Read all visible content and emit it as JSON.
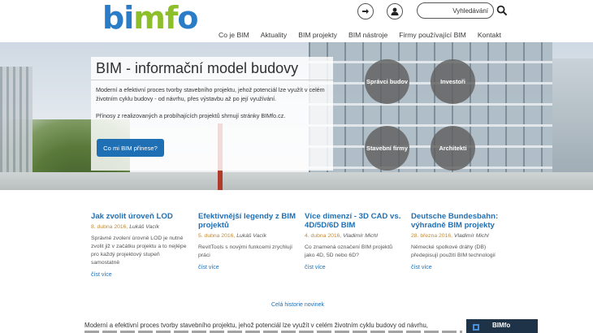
{
  "header": {
    "logo": {
      "letters": [
        "b",
        "i",
        "m",
        "f",
        "o"
      ]
    },
    "search_placeholder": "Vyhledávání",
    "nav": [
      "Co je BIM",
      "Aktuality",
      "BIM projekty",
      "BIM nástroje",
      "Firmy používající BIM",
      "Kontakt"
    ]
  },
  "hero": {
    "title": "BIM - informační model budovy",
    "text1": "Moderní a efektivní proces tvorby stavebního projektu, jehož potenciál lze využít v celém životním cyklu budovy - od návrhu, přes výstavbu až po její využívání.",
    "text2": "Přínosy z realizovaných a probíhajících projektů shrnují stránky BIMfo.cz.",
    "button_label": "Co mi BIM přinese?",
    "bubbles": [
      "Správci budov",
      "Investoři",
      "Stavební firmy",
      "Architekti"
    ]
  },
  "news": [
    {
      "title": "Jak zvolit úroveň LOD",
      "date": "8. dubna 2016,",
      "author": "Lukáš Vacík",
      "text": "Správné zvolení úrovně LOD je nutné zvolit již v začátku projektu a to nejlépe pro každý projektový stupeň samostatně",
      "more": "číst více"
    },
    {
      "title": "Efektivnější legendy z BIM projektů",
      "date": "5. dubna 2016,",
      "author": "Lukáš Vacík",
      "text": "RevitTools s novými funkcemi zrychlují práci",
      "more": "číst více"
    },
    {
      "title": "Více dimenzí - 3D CAD vs. 4D/5D/6D BIM",
      "date": "4. dubna 2016,",
      "author": "Vladimír Michl",
      "text": "Co znamená označení BIM projektů jako 4D, 5D nebo 6D?",
      "more": "číst více"
    },
    {
      "title": "Deutsche Bundesbahn: výhradně BIM projekty",
      "date": "28. března 2016,",
      "author": "Vladimír Michl",
      "text": "Německé spolkové dráhy (DB) předepisují použití BIM technologií",
      "more": "číst více"
    }
  ],
  "history_link": "Celá historie novinek",
  "footer": {
    "text": "Moderní a efektivní proces tvorby stavebního projektu, jehož potenciál lze využít v celém životním cyklu budovy od návrhu,",
    "thumb_label": "BIMfo"
  },
  "colors": {
    "brand_blue": "#1f6fb5",
    "logo_blue": "#2a7cc7",
    "logo_green": "#8cbf2a",
    "date_orange": "#c08a3a"
  }
}
